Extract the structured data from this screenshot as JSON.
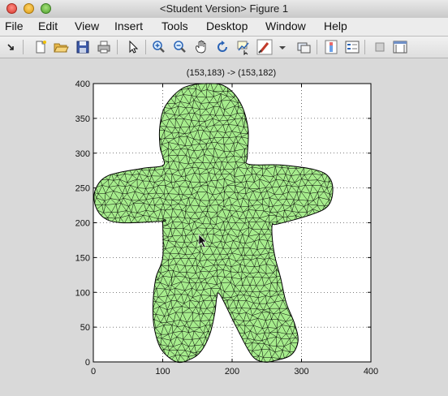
{
  "window": {
    "title": "<Student Version> Figure 1"
  },
  "menu": [
    "File",
    "Edit",
    "View",
    "Insert",
    "Tools",
    "Desktop",
    "Window",
    "Help"
  ],
  "toolbar": [
    "arrow-icon",
    "new-figure-icon",
    "open-file-icon",
    "save-icon",
    "print-icon",
    "select-pointer-icon",
    "zoom-in-icon",
    "zoom-out-icon",
    "pan-hand-icon",
    "rotate-3d-icon",
    "data-cursor-icon",
    "brush-icon",
    "brush-dropdown-icon",
    "link-plot-icon",
    "colorbar-icon",
    "legend-icon",
    "hide-plot-tools-icon",
    "show-plot-tools-icon"
  ],
  "annotation": "(153,183) -> (153,182)",
  "chart_data": {
    "type": "triangular-mesh",
    "title": "",
    "xlabel": "",
    "ylabel": "",
    "xlim": [
      0,
      400
    ],
    "ylim": [
      0,
      400
    ],
    "x_ticks": [
      "0",
      "100",
      "200",
      "300",
      "400"
    ],
    "y_ticks": [
      "0",
      "50",
      "100",
      "150",
      "200",
      "250",
      "300",
      "350",
      "400"
    ],
    "grid": true,
    "grid_style": "dotted",
    "fill_color": "#a6ec8c",
    "edge_color": "#000000",
    "outline": [
      [
        120,
        0
      ],
      [
        98,
        18
      ],
      [
        88,
        48
      ],
      [
        86,
        82
      ],
      [
        90,
        120
      ],
      [
        100,
        150
      ],
      [
        100,
        200
      ],
      [
        100,
        202
      ],
      [
        40,
        200
      ],
      [
        14,
        208
      ],
      [
        2,
        228
      ],
      [
        4,
        250
      ],
      [
        22,
        268
      ],
      [
        70,
        278
      ],
      [
        100,
        282
      ],
      [
        100,
        295
      ],
      [
        96,
        310
      ],
      [
        96,
        340
      ],
      [
        104,
        368
      ],
      [
        128,
        393
      ],
      [
        160,
        400
      ],
      [
        190,
        396
      ],
      [
        212,
        372
      ],
      [
        223,
        335
      ],
      [
        222,
        296
      ],
      [
        224,
        284
      ],
      [
        270,
        283
      ],
      [
        320,
        276
      ],
      [
        340,
        265
      ],
      [
        345,
        245
      ],
      [
        338,
        224
      ],
      [
        315,
        212
      ],
      [
        265,
        198
      ],
      [
        258,
        198
      ],
      [
        258,
        176
      ],
      [
        262,
        150
      ],
      [
        270,
        120
      ],
      [
        278,
        85
      ],
      [
        290,
        55
      ],
      [
        295,
        30
      ],
      [
        285,
        10
      ],
      [
        262,
        2
      ],
      [
        245,
        0
      ],
      [
        228,
        10
      ],
      [
        205,
        52
      ],
      [
        183,
        96
      ],
      [
        178,
        93
      ],
      [
        175,
        70
      ],
      [
        168,
        40
      ],
      [
        155,
        15
      ],
      [
        140,
        4
      ],
      [
        120,
        0
      ]
    ]
  }
}
